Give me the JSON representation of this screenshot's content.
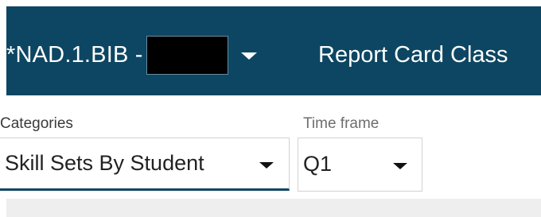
{
  "header": {
    "class_name": "*NAD.1.BIB -",
    "title": "Report Card Class"
  },
  "filters": {
    "categories": {
      "label": "Categories",
      "selected": "Skill Sets By Student"
    },
    "time_frame": {
      "label": "Time frame",
      "selected": "Q1"
    }
  },
  "colors": {
    "header_bg": "#0d4662",
    "underline_accent": "#0d4662"
  }
}
